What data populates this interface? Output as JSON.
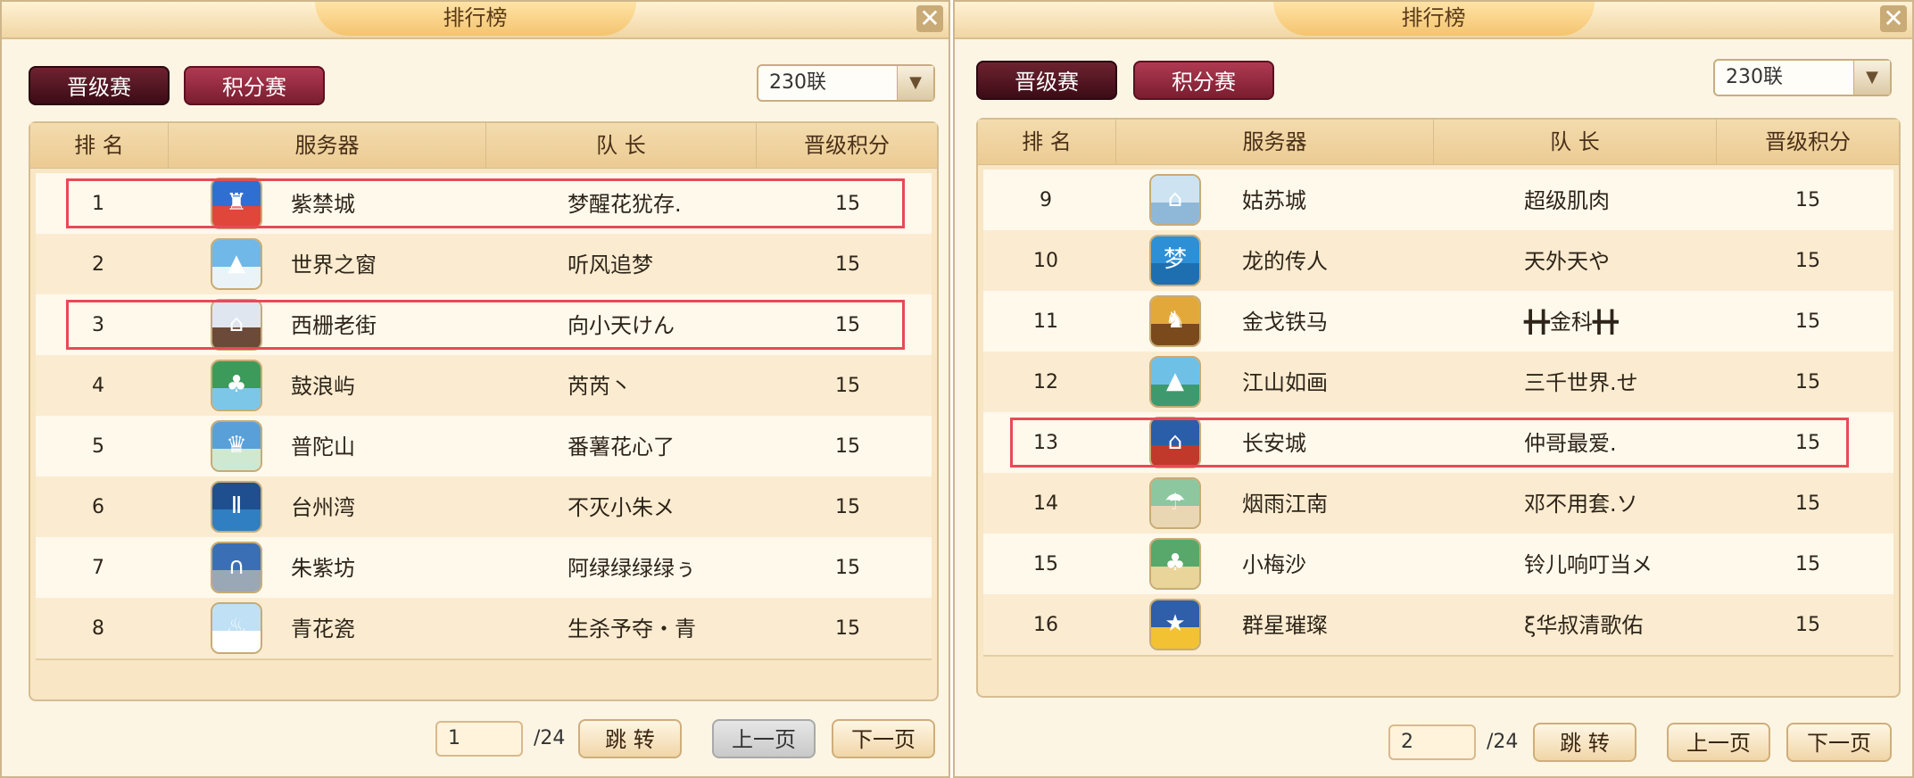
{
  "panels": [
    {
      "title": "排行榜",
      "close_label": "✕",
      "tabs": {
        "promotion": "晋级赛",
        "points": "积分赛"
      },
      "server_select": {
        "value": "230联",
        "arrow": "▼"
      },
      "columns": {
        "rank": "排 名",
        "server": "服务器",
        "captain": "队 长",
        "score": "晋级积分"
      },
      "rows": [
        {
          "rank": "1",
          "server": "紫禁城",
          "captain": "梦醒花犹存.",
          "score": "15",
          "icon": "forbidden-city-icon",
          "highlighted": true
        },
        {
          "rank": "2",
          "server": "世界之窗",
          "captain": "听风追梦",
          "score": "15",
          "icon": "snow-mountain-icon",
          "highlighted": false
        },
        {
          "rank": "3",
          "server": "西栅老街",
          "captain": "向小天けん",
          "score": "15",
          "icon": "old-street-icon",
          "highlighted": true
        },
        {
          "rank": "4",
          "server": "鼓浪屿",
          "captain": "芮芮丶",
          "score": "15",
          "icon": "island-icon",
          "highlighted": false
        },
        {
          "rank": "5",
          "server": "普陀山",
          "captain": "番薯花心了",
          "score": "15",
          "icon": "vase-icon",
          "highlighted": false
        },
        {
          "rank": "6",
          "server": "台州湾",
          "captain": "不灭小朱メ",
          "score": "15",
          "icon": "bridge-icon",
          "highlighted": false
        },
        {
          "rank": "7",
          "server": "朱紫坊",
          "captain": "阿绿绿绿绿ぅ",
          "score": "15",
          "icon": "archway-icon",
          "highlighted": false
        },
        {
          "rank": "8",
          "server": "青花瓷",
          "captain": "生杀予夺・青",
          "score": "15",
          "icon": "porcelain-icon",
          "highlighted": false
        }
      ],
      "pagination": {
        "page": "1",
        "total": "/24",
        "jump": "跳 转",
        "prev": "上一页",
        "next": "下一页"
      }
    },
    {
      "title": "排行榜",
      "close_label": "✕",
      "tabs": {
        "promotion": "晋级赛",
        "points": "积分赛"
      },
      "server_select": {
        "value": "230联",
        "arrow": "▼"
      },
      "columns": {
        "rank": "排 名",
        "server": "服务器",
        "captain": "队 长",
        "score": "晋级积分"
      },
      "rows": [
        {
          "rank": "9",
          "server": "姑苏城",
          "captain": "超级肌肉",
          "score": "15",
          "icon": "pagoda-icon",
          "highlighted": false
        },
        {
          "rank": "10",
          "server": "龙的传人",
          "captain": "天外天や",
          "score": "15",
          "icon": "dragon-emblem-icon",
          "highlighted": false
        },
        {
          "rank": "11",
          "server": "金戈铁马",
          "captain": "╋╋金科╋╋",
          "score": "15",
          "icon": "warhorse-icon",
          "highlighted": false
        },
        {
          "rank": "12",
          "server": "江山如画",
          "captain": "三千世界.せ",
          "score": "15",
          "icon": "landscape-icon",
          "highlighted": false
        },
        {
          "rank": "13",
          "server": "长安城",
          "captain": "仲哥最爱.",
          "score": "15",
          "icon": "palace-icon",
          "highlighted": true
        },
        {
          "rank": "14",
          "server": "烟雨江南",
          "captain": "邓不用套.ソ",
          "score": "15",
          "icon": "umbrella-icon",
          "highlighted": false
        },
        {
          "rank": "15",
          "server": "小梅沙",
          "captain": "铃儿响叮当メ",
          "score": "15",
          "icon": "beach-icon",
          "highlighted": false
        },
        {
          "rank": "16",
          "server": "群星璀璨",
          "captain": "ξ华叔清歌佑",
          "score": "15",
          "icon": "star-icon",
          "highlighted": false
        }
      ],
      "pagination": {
        "page": "2",
        "total": "/24",
        "jump": "跳 转",
        "prev": "上一页",
        "next": "下一页"
      }
    }
  ],
  "colors": {
    "highlight": "#e84a56",
    "tab_active": "#4a1420",
    "tab_inactive": "#9b2c44",
    "title_bar": "#f4c46f"
  }
}
